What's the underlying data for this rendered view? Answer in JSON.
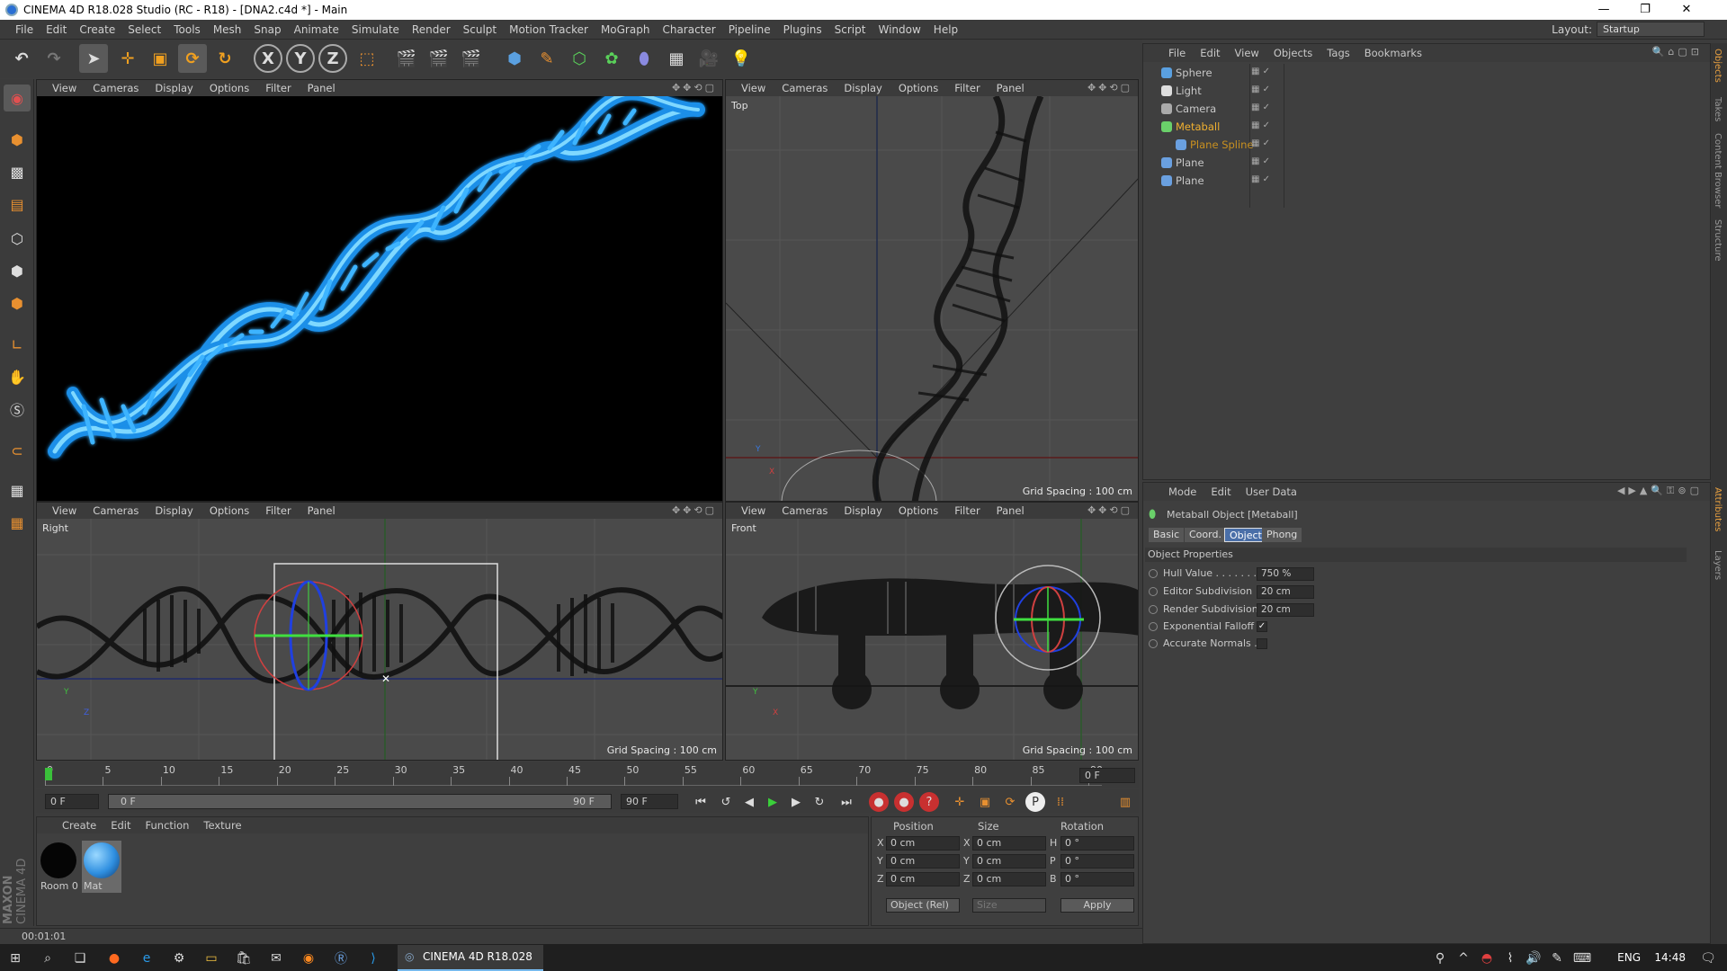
{
  "window": {
    "title": "CINEMA 4D R18.028 Studio (RC - R18) - [DNA2.c4d *] - Main",
    "controls": [
      "—",
      "❐",
      "✕"
    ]
  },
  "menubar": {
    "items": [
      "File",
      "Edit",
      "Create",
      "Select",
      "Tools",
      "Mesh",
      "Snap",
      "Animate",
      "Simulate",
      "Render",
      "Sculpt",
      "Motion Tracker",
      "MoGraph",
      "Character",
      "Pipeline",
      "Plugins",
      "Script",
      "Window",
      "Help"
    ],
    "layout_label": "Layout:",
    "layout_value": "Startup"
  },
  "viewport_menu": [
    "View",
    "Cameras",
    "Display",
    "Options",
    "Filter",
    "Panel"
  ],
  "viewports": {
    "perspective": {
      "label": ""
    },
    "top": {
      "label": "Top",
      "grid": "Grid Spacing : 100 cm"
    },
    "right": {
      "label": "Right",
      "grid": "Grid Spacing : 100 cm"
    },
    "front": {
      "label": "Front",
      "grid": "Grid Spacing : 100 cm"
    }
  },
  "timeline": {
    "ticks": [
      "0",
      "5",
      "10",
      "15",
      "20",
      "25",
      "30",
      "35",
      "40",
      "45",
      "50",
      "55",
      "60",
      "65",
      "70",
      "75",
      "80",
      "85",
      "90"
    ],
    "current_frame": "0 F",
    "start": "0 F",
    "range_start": "0 F",
    "range_end": "90 F",
    "end": "90 F"
  },
  "material_manager": {
    "menu": [
      "Create",
      "Edit",
      "Function",
      "Texture"
    ],
    "materials": [
      {
        "name": "Room 0",
        "color": "#050505"
      },
      {
        "name": "Mat",
        "color": "#2f8fe0"
      }
    ]
  },
  "coordinates": {
    "headers": [
      "Position",
      "Size",
      "Rotation"
    ],
    "rows": [
      {
        "axis": "X",
        "pos": "0 cm",
        "size_axis": "X",
        "size": "0 cm",
        "rot_axis": "H",
        "rot": "0 °"
      },
      {
        "axis": "Y",
        "pos": "0 cm",
        "size_axis": "Y",
        "size": "0 cm",
        "rot_axis": "P",
        "rot": "0 °"
      },
      {
        "axis": "Z",
        "pos": "0 cm",
        "size_axis": "Z",
        "size": "0 cm",
        "rot_axis": "B",
        "rot": "0 °"
      }
    ],
    "mode": "Object (Rel)",
    "size_mode": "Size",
    "apply": "Apply"
  },
  "status": {
    "time": "00:01:01"
  },
  "object_manager": {
    "menu": [
      "File",
      "Edit",
      "View",
      "Objects",
      "Tags",
      "Bookmarks"
    ],
    "objects": [
      {
        "name": "Sphere",
        "color": "#c8c8c8",
        "icon_color": "#5aa0e0"
      },
      {
        "name": "Light",
        "color": "#c8c8c8",
        "icon_color": "#dddddd"
      },
      {
        "name": "Camera",
        "color": "#c8c8c8",
        "icon_color": "#aaaaaa"
      },
      {
        "name": "Metaball",
        "color": "#f0b030",
        "icon_color": "#6ad06a"
      },
      {
        "name": "Plane Spline",
        "color": "#c89020",
        "icon_color": "#6aa0e0"
      },
      {
        "name": "Plane",
        "color": "#c8c8c8",
        "icon_color": "#6aa0e0"
      },
      {
        "name": "Plane",
        "color": "#c8c8c8",
        "icon_color": "#6aa0e0"
      }
    ]
  },
  "attribute_manager": {
    "menu": [
      "Mode",
      "Edit",
      "User Data"
    ],
    "object_title": "Metaball Object [Metaball]",
    "tabs": [
      "Basic",
      "Coord.",
      "Object",
      "Phong"
    ],
    "active_tab": "Object",
    "section": "Object Properties",
    "props": [
      {
        "label": "Hull Value . . . . . . .",
        "value": "750 %"
      },
      {
        "label": "Editor Subdivision",
        "value": "20 cm"
      },
      {
        "label": "Render Subdivision",
        "value": "20 cm"
      },
      {
        "label": "Exponential Falloff",
        "value": "✓"
      },
      {
        "label": "Accurate Normals .",
        "value": ""
      }
    ]
  },
  "right_tabs": [
    "Objects",
    "Takes",
    "Content Browser",
    "Structure",
    "Attributes",
    "Layers"
  ],
  "branding": {
    "maker": "MAXON",
    "product": "CINEMA 4D"
  },
  "taskbar": {
    "active_app": "CINEMA 4D R18.028 S...",
    "lang": "ENG",
    "clock": "14:48"
  }
}
